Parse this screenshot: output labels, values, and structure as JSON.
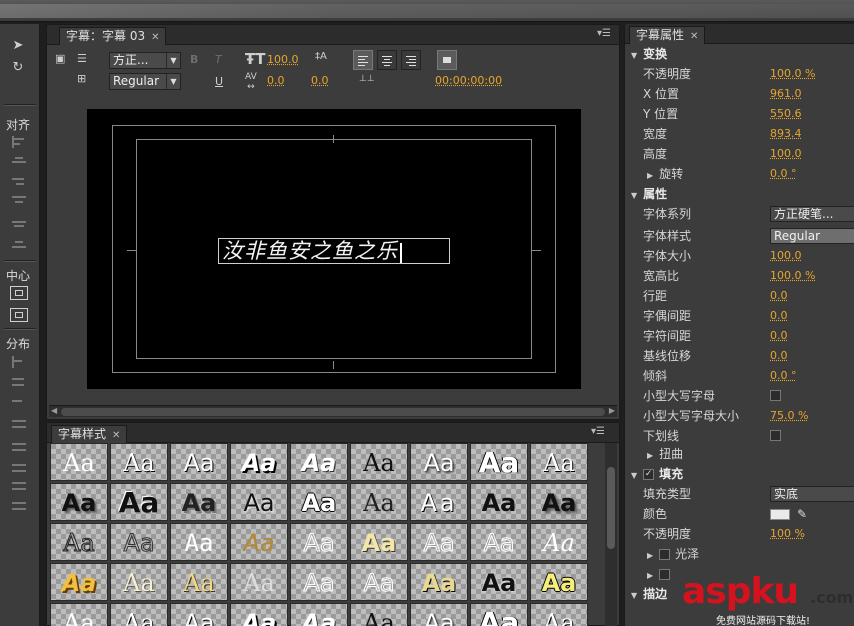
{
  "title_panel": {
    "tab_label": "字幕：字幕 03",
    "font_family": "方正...",
    "font_style": "Regular",
    "font_size": "100.0",
    "kerning": "0.0",
    "leading": "0.0",
    "timecode": "00:00:00:00",
    "title_text": "汝非鱼安之鱼之乐"
  },
  "tools_panel": {
    "align_label": "对齐",
    "center_label": "中心",
    "distribute_label": "分布"
  },
  "styles_panel": {
    "tab_label": "字幕样式",
    "sample_text": "Aa"
  },
  "properties_panel": {
    "tab_label": "字幕属性",
    "transform": {
      "label": "变换",
      "opacity_label": "不透明度",
      "opacity": "100.0 %",
      "x_label": "X 位置",
      "x": "961.0",
      "y_label": "Y 位置",
      "y": "550.6",
      "width_label": "宽度",
      "width": "893.4",
      "height_label": "高度",
      "height": "100.0",
      "rotation_label": "旋转",
      "rotation": "0.0 °"
    },
    "properties": {
      "label": "属性",
      "font_family_label": "字体系列",
      "font_family": "方正硬笔...",
      "font_style_label": "字体样式",
      "font_style": "Regular",
      "font_size_label": "字体大小",
      "font_size": "100.0",
      "aspect_label": "宽高比",
      "aspect": "100.0 %",
      "leading_label": "行距",
      "leading": "0.0",
      "kerning_label": "字偶间距",
      "kerning": "0.0",
      "tracking_label": "字符间距",
      "tracking": "0.0",
      "baseline_label": "基线位移",
      "baseline": "0.0",
      "slant_label": "倾斜",
      "slant": "0.0 °",
      "small_caps_label": "小型大写字母",
      "small_caps_size_label": "小型大写字母大小",
      "small_caps_size": "75.0 %",
      "underline_label": "下划线",
      "distort_label": "扭曲"
    },
    "fill": {
      "label": "填充",
      "fill_type_label": "填充类型",
      "fill_type": "实底",
      "color_label": "颜色",
      "color": "#eaeaea",
      "opacity_label": "不透明度",
      "opacity": "100 %",
      "sheen_label": "光泽"
    },
    "stroke": {
      "label": "描边"
    }
  },
  "watermark": {
    "main": "aspku",
    "domain": ".com",
    "tagline": "免费网站源码下载站!"
  },
  "colors": {
    "panel_bg": "#3c3c3c",
    "value_orange": "#e6a52c",
    "watermark_red": "#d6121e"
  }
}
